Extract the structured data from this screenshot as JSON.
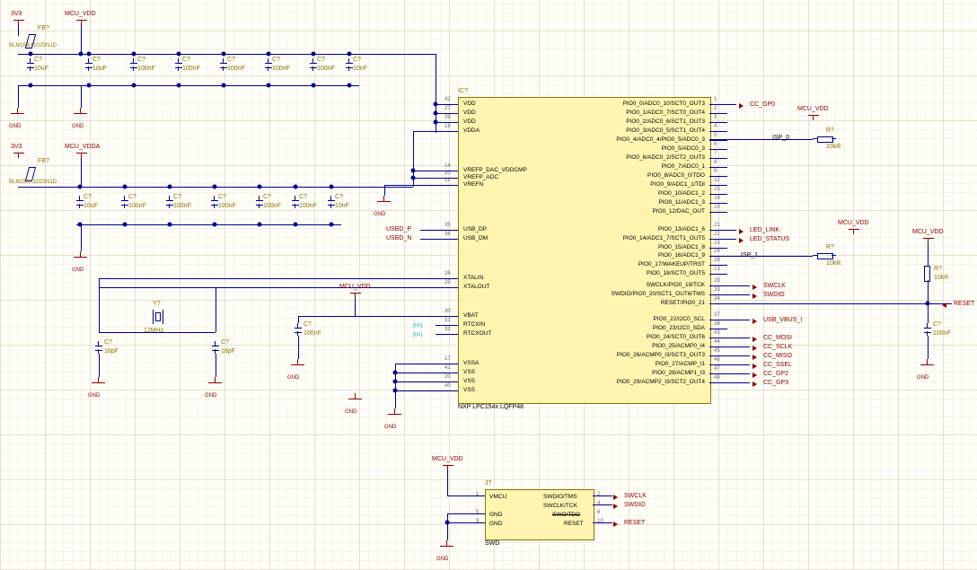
{
  "chart_data": {
    "type": "schematic",
    "main_ic": {
      "refdes": "IC?",
      "part": "NXP LPC154x LQFP48",
      "left_pins": [
        {
          "num": "42",
          "name": "VDD"
        },
        {
          "num": "27",
          "name": "VDD"
        },
        {
          "num": "39",
          "name": "VDD"
        },
        {
          "num": "16",
          "name": "VDDA"
        },
        {
          "num": "14",
          "name": "VREFP_DAC_VDDCMP"
        },
        {
          "num": "10",
          "name": "VREFP_ADC"
        },
        {
          "num": "11",
          "name": "VREFN"
        },
        {
          "num": "35",
          "name": "USB_DP"
        },
        {
          "num": "36",
          "name": "USB_DM"
        },
        {
          "num": "26",
          "name": "XTALIN"
        },
        {
          "num": "25",
          "name": "XTALOUT"
        },
        {
          "num": "30",
          "name": "VBAT"
        },
        {
          "num": "31",
          "name": "RTCXIN"
        },
        {
          "num": "32",
          "name": "RTCXOUT"
        },
        {
          "num": "17",
          "name": "VSSA"
        },
        {
          "num": "41",
          "name": "VSS"
        },
        {
          "num": "20",
          "name": "VSS"
        },
        {
          "num": "40",
          "name": "VSS"
        }
      ],
      "right_pins": [
        {
          "num": "1",
          "name": "PIO0_0/ADC0_10/SCT0_OUT3"
        },
        {
          "num": "2",
          "name": "PIO0_1/ADC0_7/SCT0_OUT4"
        },
        {
          "num": "3",
          "name": "PIO0_2/ADC0_6/SCT1_OUT3"
        },
        {
          "num": "4",
          "name": "PIO0_3/ADC0_5/SCT1_OUT4"
        },
        {
          "num": "5",
          "name": "PIO0_4/ADC0_4/PIO0_5/ADC0_3"
        },
        {
          "num": "6",
          "name": "PIO0_5/ADC0_3"
        },
        {
          "num": "7",
          "name": "PIO0_6/ADC0_2/SCT2_OUT3"
        },
        {
          "num": "8",
          "name": "PIO0_7/ADC0_1"
        },
        {
          "num": "9",
          "name": "PIO0_8/ADC0_0/TDO"
        },
        {
          "num": "12",
          "name": "PIO0_9/ADC1_1/TDI"
        },
        {
          "num": "15",
          "name": "PIO0_10/ADC1_2"
        },
        {
          "num": "18",
          "name": "PIO0_11/ADC1_3"
        },
        {
          "num": "19",
          "name": "PIO0_12/DAC_OUT"
        },
        {
          "num": "21",
          "name": "PIO0_13/ADC1_6"
        },
        {
          "num": "22",
          "name": "PIO0_14/ADC1_7/SCT1_OUT5"
        },
        {
          "num": "23",
          "name": "PIO0_15/ADC1_8"
        },
        {
          "num": "24",
          "name": "PIO0_16/ADC1_9"
        },
        {
          "num": "28",
          "name": "PIO0_17/WAKEUP/TRST"
        },
        {
          "num": "13",
          "name": "PIO0_18/SCT0_OUT5"
        },
        {
          "num": "29",
          "name": "SWCLK/PIO0_19/TCK"
        },
        {
          "num": "33",
          "name": "SWDIO/PIO0_20/SCT1_OUT6/TMS"
        },
        {
          "num": "34",
          "name": "RESET/PIO0_21"
        },
        {
          "num": "37",
          "name": "PIO0_22/I2C0_SCL"
        },
        {
          "num": "38",
          "name": "PIO0_23/I2C0_SDA"
        },
        {
          "num": "43",
          "name": "PIO0_24/SCT0_OUT6"
        },
        {
          "num": "44",
          "name": "PIO0_25/ACMP0_I4"
        },
        {
          "num": "45",
          "name": "PIO0_26/ACMP0_I3/SCT3_OUT3"
        },
        {
          "num": "46",
          "name": "PIO0_27/ACMP_I1"
        },
        {
          "num": "47",
          "name": "PIO0_28/ACMP1_I3"
        },
        {
          "num": "48",
          "name": "PIO0_29/ACMP2_I3/SCT2_OUT4"
        }
      ]
    },
    "swd_connector": {
      "refdes": "J?",
      "name": "SWD",
      "left_pins": [
        {
          "num": "1",
          "name": "VMCU"
        },
        {
          "num": "5",
          "name": "GND"
        },
        {
          "num": "9",
          "name": "GND"
        }
      ],
      "right_pins": [
        {
          "num": "2",
          "name": "SWDIO/TMS"
        },
        {
          "num": "4",
          "name": "SWCLK/TCK"
        },
        {
          "num": "6",
          "name": "SWO/TDO"
        },
        {
          "num": "10",
          "name": "RESET"
        }
      ]
    },
    "nets": {
      "power": [
        "3V3",
        "MCU_VDD",
        "MCU_VDDA",
        "GND"
      ],
      "signals": [
        "CC_GP0",
        "ISP_0",
        "ISP_1",
        "LED_LINK",
        "LED_STATUS",
        "SWCLK",
        "SWDIO",
        "RESET",
        "USB_VBUS_I",
        "CC_MOSI",
        "CC_SCLK",
        "CC_MISO",
        "CC_SSEL",
        "CC_GP2",
        "CC_GP3",
        "USBD_P",
        "USBD_N"
      ]
    },
    "passives": {
      "ferrite_beads": [
        {
          "ref": "FB?",
          "part": "BLM15AX102SN1D"
        },
        {
          "ref": "FB?",
          "part": "BLM15AX102SN1D"
        }
      ],
      "caps_top": [
        {
          "ref": "C?",
          "v": "10uF"
        },
        {
          "ref": "C?",
          "v": "10uF"
        },
        {
          "ref": "C?",
          "v": "100nF"
        },
        {
          "ref": "C?",
          "v": "100nF"
        },
        {
          "ref": "C?",
          "v": "100nF"
        },
        {
          "ref": "C?",
          "v": "100nF"
        },
        {
          "ref": "C?",
          "v": "100nF"
        },
        {
          "ref": "C?",
          "v": "10nF"
        }
      ],
      "caps_mid": [
        {
          "ref": "C?",
          "v": "10uF"
        },
        {
          "ref": "C?",
          "v": "100nF"
        },
        {
          "ref": "C?",
          "v": "100nF"
        },
        {
          "ref": "C?",
          "v": "100nF"
        },
        {
          "ref": "C?",
          "v": "100nF"
        },
        {
          "ref": "C?",
          "v": "100nF"
        },
        {
          "ref": "C?",
          "v": "10nF"
        }
      ],
      "caps_xtal": [
        {
          "ref": "C?",
          "v": "18pF"
        },
        {
          "ref": "C?",
          "v": "18pF"
        },
        {
          "ref": "C?",
          "v": "100nF"
        }
      ],
      "caps_reset": [
        {
          "ref": "C?",
          "v": "100nF"
        }
      ],
      "crystal": {
        "ref": "Y?",
        "freq": "12MHz"
      },
      "resistors": [
        {
          "ref": "R?",
          "v": "10kR"
        },
        {
          "ref": "R?",
          "v": "10kR"
        },
        {
          "ref": "R?",
          "v": "10kR"
        }
      ]
    },
    "nc_pins": [
      "(nc)",
      "(nc)"
    ]
  },
  "labels": {
    "ic_ref": "IC?",
    "ic_part": "NXP LPC154x LQFP48",
    "swd": "SWD",
    "j": "J?",
    "v3": "3V3",
    "mcuvdd": "MCU_VDD",
    "mcuvdda": "MCU_VDDA",
    "gnd": "GND",
    "fb": "FB?",
    "blm": "BLM15AX102SN1D",
    "c": "C?",
    "r": "R?",
    "y": "Y?",
    "u10": "10uF",
    "n100": "100nF",
    "n10": "10nF",
    "p18": "18pF",
    "k10": "10kR",
    "mhz12": "12MHz",
    "ccgp0": "CC_GP0",
    "isp0": "ISP_0",
    "isp1": "ISP_1",
    "ledlink": "LED_LINK",
    "ledstat": "LED_STATUS",
    "swclk": "SWCLK",
    "swdio": "SWDIO",
    "reset": "RESET",
    "usbvbus": "USB_VBUS_I",
    "ccmosi": "CC_MOSI",
    "ccsclk": "CC_SCLK",
    "ccmiso": "CC_MISO",
    "ccssel": "CC_SSEL",
    "ccgp2": "CC_GP2",
    "ccgp3": "CC_GP3",
    "usbdp": "USBD_P",
    "usbdn": "USBD_N",
    "nc": "(nc)"
  }
}
